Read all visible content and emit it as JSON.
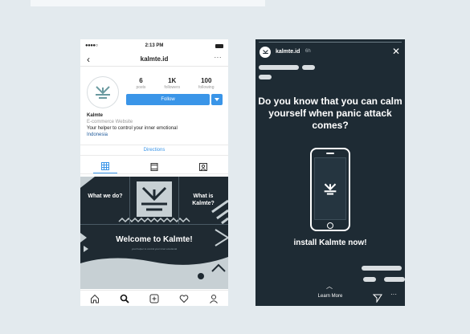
{
  "profile": {
    "status_time": "2:13 PM",
    "status_signal": "●●●●○",
    "username": "kalmte.id",
    "back_glyph": "‹",
    "more_glyph": "···",
    "stats": [
      {
        "num": "6",
        "label": "posts"
      },
      {
        "num": "1K",
        "label": "followers"
      },
      {
        "num": "100",
        "label": "following"
      }
    ],
    "follow_label": "Follow",
    "name": "Kalmte",
    "category": "E-commerce Website",
    "description": "Your helper to control your inner emotional",
    "location": "Indonesia",
    "directions_label": "Directions",
    "grid": {
      "cell1": "What we do?",
      "cell3": "What is Kalmte?",
      "welcome": "Welcome to Kalmte!",
      "sub": "your helper to control your inner emotional"
    }
  },
  "story": {
    "username": "kalmte.id",
    "time": "6h",
    "close_glyph": "✕",
    "question": "Do you know that you can calm yourself when panic attack comes?",
    "cta": "install Kalmte now!",
    "learn_more": "Learn More",
    "chevron": "︿",
    "more_glyph": "···"
  },
  "colors": {
    "accent": "#3a95e8",
    "dark": "#1e2b34",
    "background": "#e3eaee"
  },
  "icons": [
    "back-icon",
    "more-icon",
    "grid-icon",
    "igtv-icon",
    "tagged-icon",
    "home-icon",
    "search-icon",
    "add-icon",
    "heart-icon",
    "profile-icon",
    "close-icon",
    "send-icon",
    "kalmte-logo-icon"
  ]
}
